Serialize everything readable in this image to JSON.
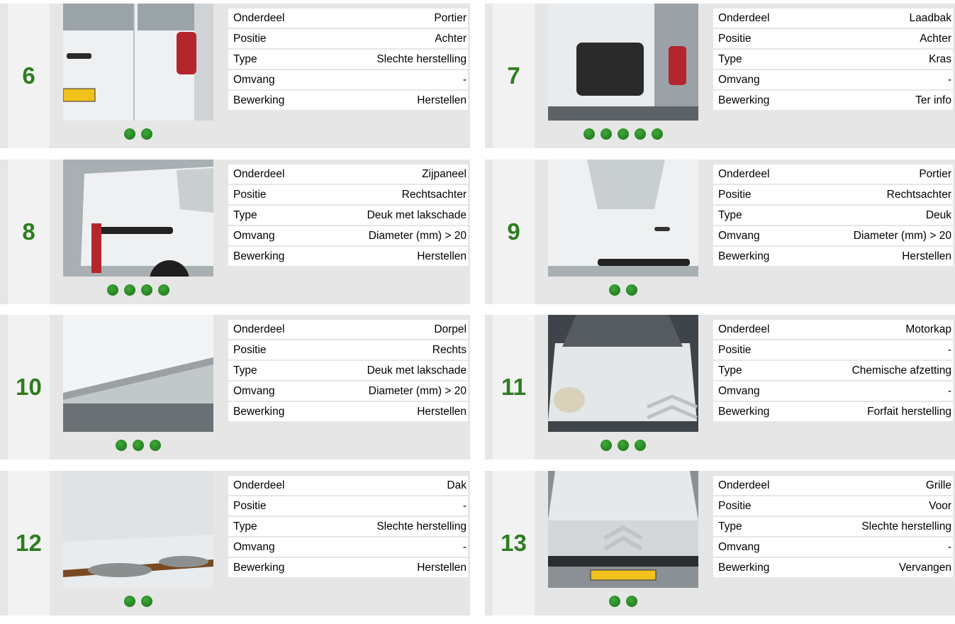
{
  "labels": {
    "part": "Onderdeel",
    "position": "Positie",
    "type": "Type",
    "extent": "Omvang",
    "action": "Bewerking"
  },
  "items": [
    {
      "number": "6",
      "part": "Portier",
      "position": "Achter",
      "type": "Slechte herstelling",
      "extent": "-",
      "action": "Herstellen",
      "photo_count": 2,
      "photo_subject": "van-rear-door"
    },
    {
      "number": "7",
      "part": "Laadbak",
      "position": "Achter",
      "type": "Kras",
      "extent": "-",
      "action": "Ter info",
      "photo_count": 5,
      "photo_subject": "cargo-area-open-door"
    },
    {
      "number": "8",
      "part": "Zijpaneel",
      "position": "Rechtsachter",
      "type": "Deuk met lakschade",
      "extent": "Diameter (mm) > 20",
      "action": "Herstellen",
      "photo_count": 4,
      "photo_subject": "side-panel-rear-right"
    },
    {
      "number": "9",
      "part": "Portier",
      "position": "Rechtsachter",
      "type": "Deuk",
      "extent": "Diameter (mm) > 20",
      "action": "Herstellen",
      "photo_count": 2,
      "photo_subject": "sliding-door-right"
    },
    {
      "number": "10",
      "part": "Dorpel",
      "position": "Rechts",
      "type": "Deuk met lakschade",
      "extent": "Diameter (mm) > 20",
      "action": "Herstellen",
      "photo_count": 3,
      "photo_subject": "sill-right"
    },
    {
      "number": "11",
      "part": "Motorkap",
      "position": "-",
      "type": "Chemische afzetting",
      "extent": "-",
      "action": "Forfait herstelling",
      "photo_count": 3,
      "photo_subject": "hood-front"
    },
    {
      "number": "12",
      "part": "Dak",
      "position": "-",
      "type": "Slechte herstelling",
      "extent": "-",
      "action": "Herstellen",
      "photo_count": 2,
      "photo_subject": "roof-rust"
    },
    {
      "number": "13",
      "part": "Grille",
      "position": "Voor",
      "type": "Slechte herstelling",
      "extent": "-",
      "action": "Vervangen",
      "photo_count": 2,
      "photo_subject": "front-grille"
    }
  ],
  "colors": {
    "accent_number": "#2e7d1f",
    "dot": "#2a8a26",
    "card_bg": "#e6e6e6",
    "number_bg": "#f2f2f2"
  }
}
